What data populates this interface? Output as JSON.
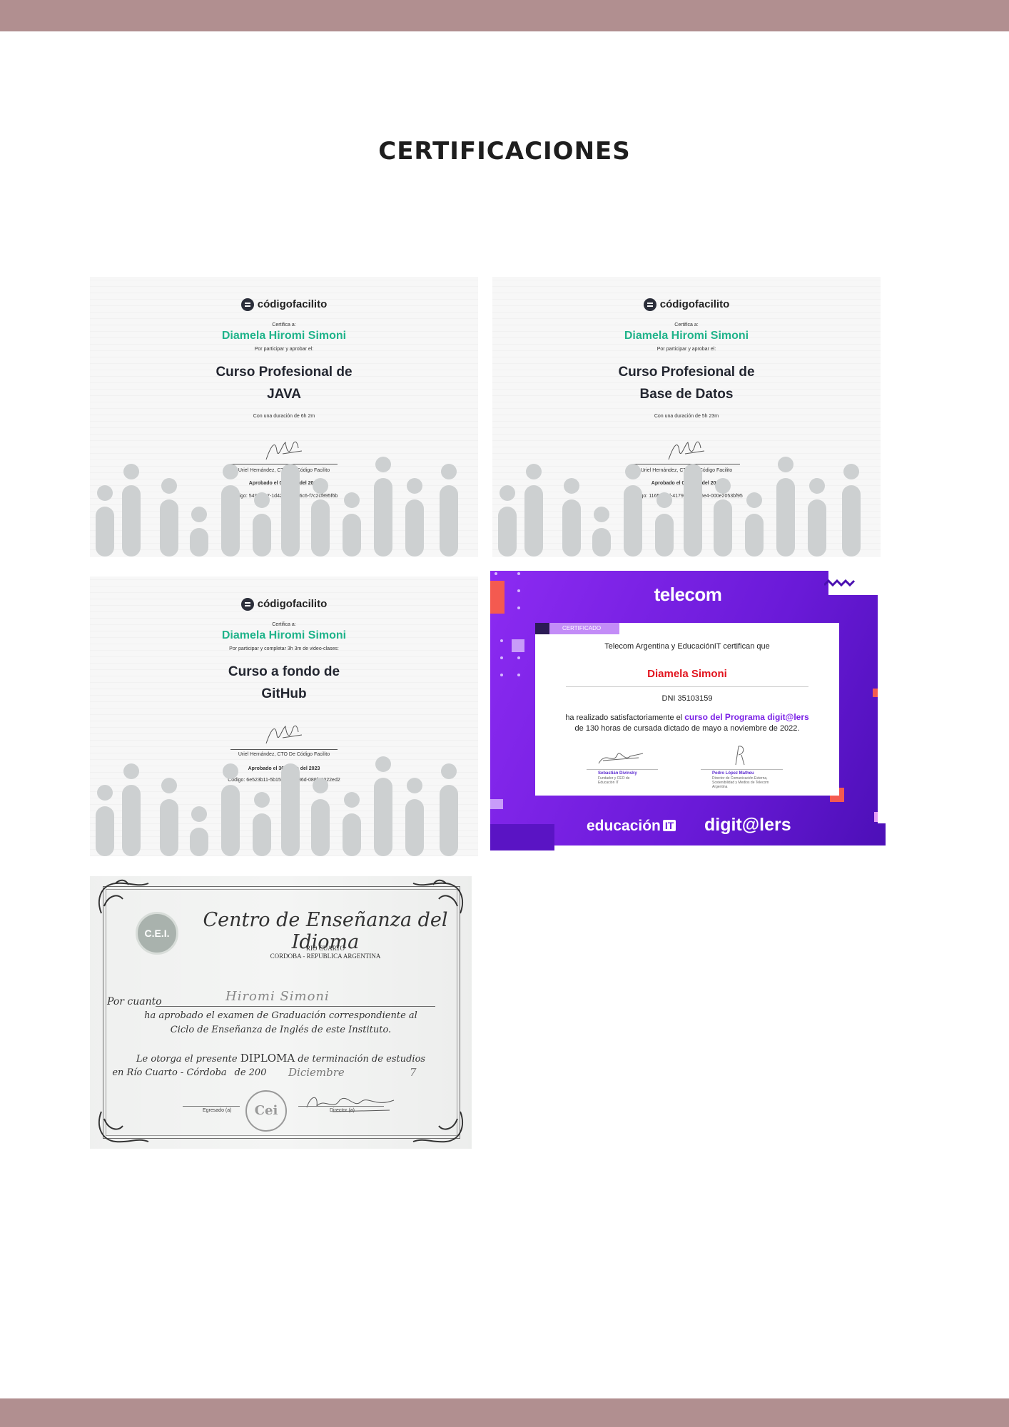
{
  "page": {
    "title": "CERTIFICACIONES",
    "colors": {
      "bar": "#b18f90",
      "background": "#ffffff"
    }
  },
  "certificates": {
    "java": {
      "brand": "códigofacilito",
      "certifies": "Certifica a:",
      "name": "Diamela Hiromi Simoni",
      "reason": "Por participar y aprobar el:",
      "course_line1": "Curso Profesional de",
      "course_line2": "JAVA",
      "duration": "Con una duración de 6h 2m",
      "signer": "Uriel Hernández, CTO De Código Facilito",
      "approved": "Aprobado el 01 Julio del 2023",
      "code": "Código: 5491fe07-1d42-417c-b6c6-f7c2cf895f6b"
    },
    "db": {
      "brand": "códigofacilito",
      "certifies": "Certifica a:",
      "name": "Diamela Hiromi Simoni",
      "reason": "Por participar y aprobar el:",
      "course_line1": "Curso Profesional de",
      "course_line2": "Base de Datos",
      "duration": "Con una duración de 5h 23m",
      "signer": "Uriel Hernández, CTO De Código Facilito",
      "approved": "Aprobado el 02 Julio del 2023",
      "code": "Código: 1165405d-4179-462b-85e4-000e2053bf95"
    },
    "github": {
      "brand": "códigofacilito",
      "certifies": "Certifica a:",
      "name": "Diamela Hiromi Simoni",
      "reason": "Por participar y completar 3h 3m de video-clases:",
      "course_line1": "Curso a fondo de",
      "course_line2": "GitHub",
      "signer": "Uriel Hernández, CTO De Código Facilito",
      "approved": "Aprobado el 30 Junio del 2023",
      "code": "Código: 6e523b11-5b15-4286-b36d-088f43022ed2"
    },
    "telecom": {
      "brand": "telecom",
      "tab": "CERTIFICADO",
      "line1": "Telecom Argentina y EducaciónIT certifican que",
      "name": "Diamela Simoni",
      "dni": "DNI 35103159",
      "line2_pre": "ha realizado satisfactoriamente el",
      "line2_highlight": "curso del Programa digit@lers",
      "line3": "de 130 horas de cursada dictado de mayo a noviembre de 2022.",
      "signer1": "Sebastián Divinsky",
      "signer1_role": "Fundador y CEO de Educación IT",
      "signer2": "Pedro López Matheu",
      "signer2_role": "Director de Comunicación Externa, Sostenibilidad y Medios de Telecom Argentina",
      "logo_edu": "educación",
      "logo_it": "IT",
      "logo_digilers": "digit@lers",
      "accent": "#7b22e8"
    },
    "cei": {
      "seal": "C.E.I.",
      "heading": "Centro de Enseñanza del Idioma",
      "city": "RIO CUARTO",
      "country": "CORDOBA - REPUBLICA ARGENTINA",
      "por_cuanto": "Por cuanto",
      "student": "Hiromi Simoni",
      "line1": "ha aprobado el examen de Graduación correspondiente al",
      "line2": "Ciclo de Enseñanza de Inglés de este Instituto.",
      "line3_pre": "Le otorga el presente",
      "line3_caps": "DIPLOMA",
      "line3_post": "de terminación de estudios",
      "line4": "en Río Cuarto - Córdoba",
      "month": "Diciembre",
      "year_prefix": "de 200",
      "year_digit": "7",
      "stamp": "Cei",
      "graduate_label": "Egresado (a)",
      "director_label": "Director (a)"
    }
  }
}
